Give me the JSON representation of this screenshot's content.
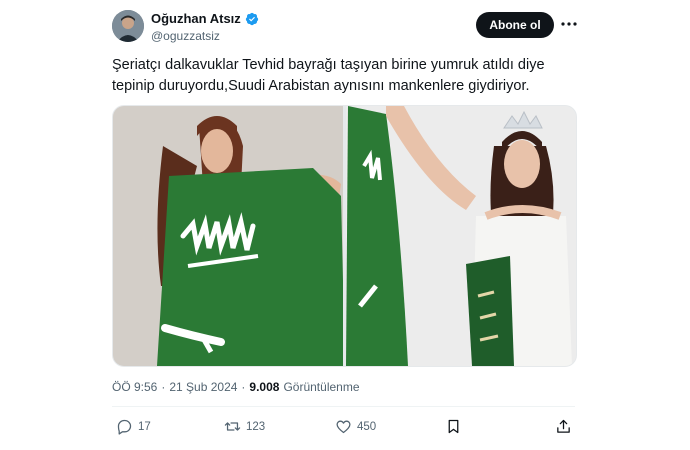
{
  "author": {
    "display_name": "Oğuzhan Atsız",
    "handle": "@oguzzatsiz",
    "verified": true
  },
  "header": {
    "follow_label": "Abone ol",
    "more_icon": "more-horizontal-icon"
  },
  "tweet": {
    "text": "Şeriatçı dalkavuklar Tevhid bayrağı taşıyan birine yumruk atıldı diye tepinip duruyordu,Suudi Arabistan aynısını mankenlere giydiriyor."
  },
  "meta": {
    "time": "ÖÖ 9:56",
    "separator": "·",
    "date": "21 Şub 2024",
    "views_count": "9.008",
    "views_label": "Görüntülenme"
  },
  "actions": {
    "replies": "17",
    "retweets": "123",
    "likes": "450",
    "icons": [
      "reply-icon",
      "retweet-icon",
      "like-icon",
      "bookmark-icon",
      "share-icon"
    ]
  },
  "colors": {
    "verified_blue": "#1d9bf0",
    "flag_green": "#2b7a35",
    "text_primary": "#0f1419",
    "text_secondary": "#536471"
  }
}
